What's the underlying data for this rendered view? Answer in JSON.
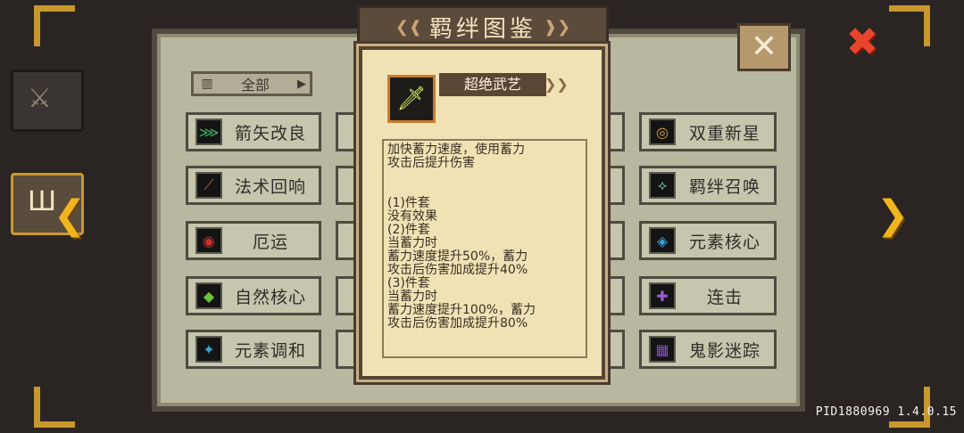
{
  "title": "羁绊图鉴",
  "title_deco_left": "❮❰",
  "title_deco_right": "❱❯",
  "filter": {
    "label": "全部",
    "icon": "grid-icon",
    "caret": "▶"
  },
  "side_tabs": [
    {
      "name": "weapon-tab",
      "glyph": "⚔",
      "active": false
    },
    {
      "name": "bond-tab",
      "glyph": "Ш",
      "active": true
    }
  ],
  "nav": {
    "left": "❮",
    "right": "❯"
  },
  "close_glyph": "✕",
  "main_close_glyph": "✖",
  "cards_left": [
    {
      "label": "箭矢改良",
      "icon": "arrows-icon",
      "icon_color": "#3fae5a"
    },
    {
      "label": "法术回响",
      "icon": "staff-icon",
      "icon_color": "#b06a3a"
    },
    {
      "label": "厄运",
      "icon": "curse-icon",
      "icon_color": "#d0322c"
    },
    {
      "label": "自然核心",
      "icon": "gem-icon",
      "icon_color": "#6fbf3a"
    },
    {
      "label": "元素调和",
      "icon": "element-icon",
      "icon_color": "#3aa6d8"
    }
  ],
  "cards_right": [
    {
      "label": "双重新星",
      "icon": "nova-icon",
      "icon_color": "#d9a23a"
    },
    {
      "label": "羁绊召唤",
      "icon": "summon-icon",
      "icon_color": "#7fc9c0"
    },
    {
      "label": "元素核心",
      "icon": "core-icon",
      "icon_color": "#3c9fd6"
    },
    {
      "label": "连击",
      "icon": "combo-icon",
      "icon_color": "#9b5cd6"
    },
    {
      "label": "鬼影迷踪",
      "icon": "ghost-icon",
      "icon_color": "#8a4cc9"
    }
  ],
  "tooltip": {
    "name": "超绝武艺",
    "chevrons": "❯❯",
    "icon": "sword-icon",
    "description": "加快蓄力速度，使用蓄力\n攻击后提升伤害\n\n\n(1)件套\n没有效果\n(2)件套\n当蓄力时\n蓄力速度提升50%，蓄力\n攻击后伤害加成提升40%\n(3)件套\n当蓄力时\n蓄力速度提升100%，蓄力\n攻击后伤害加成提升80%"
  },
  "version": "PID1880969 1.4.0.15"
}
